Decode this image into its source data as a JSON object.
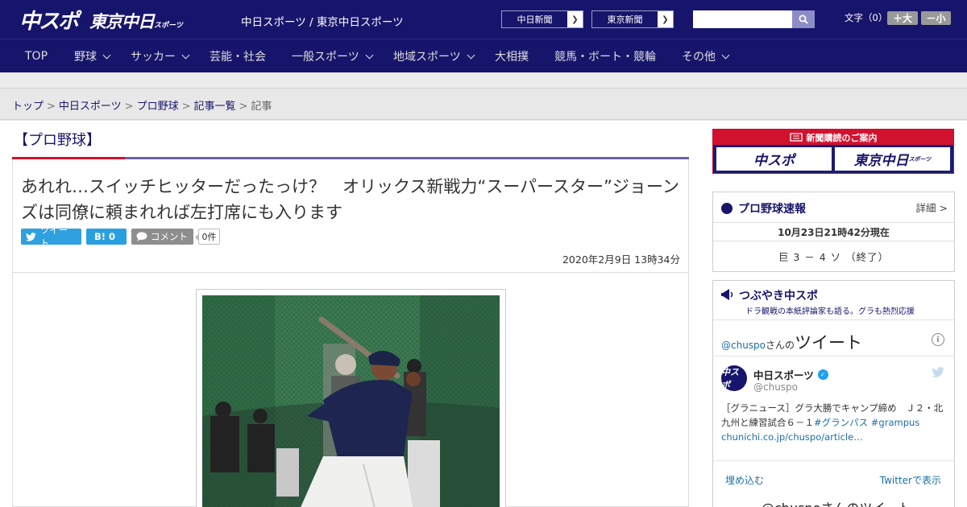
{
  "header": {
    "logo_main": "中スポ",
    "logo_sub": "東京中日",
    "logo_sub_small": "スポーツ",
    "site_name": "中日スポーツ / 東京中日スポーツ",
    "link_chunichi": "中日新聞",
    "link_tokyo": "東京新聞",
    "search_placeholder": "",
    "font_size_label": "文字（0）",
    "font_plus": "＋大",
    "font_minus": "－小"
  },
  "nav": {
    "items": [
      {
        "label": "TOP"
      },
      {
        "label": "野球"
      },
      {
        "label": "サッカー"
      },
      {
        "label": "芸能・社会"
      },
      {
        "label": "一般スポーツ"
      },
      {
        "label": "地域スポーツ"
      },
      {
        "label": "大相撲"
      },
      {
        "label": "競馬・ボート・競輪"
      },
      {
        "label": "その他"
      }
    ]
  },
  "breadcrumb": [
    "トップ",
    "中日スポーツ",
    "プロ野球",
    "記事一覧",
    "記事"
  ],
  "article": {
    "category": "【プロ野球】",
    "title": "あれれ…スイッチヒッターだったっけ？　オリックス新戦力“スーパースター”ジョーンズは同僚に頼まれれば左打席にも入ります",
    "tweet_label": "ツイート",
    "hatena_label": "B! 0",
    "comment_label": "コメント",
    "comment_count": "0件",
    "date": "2020年2月9日 13時34分"
  },
  "sidebar": {
    "subscribe_title": "新聞購読のご案内",
    "subscribe_1": "中スポ",
    "subscribe_2": "東京中日",
    "subscribe_2_small": "スポーツ",
    "score": {
      "title": "プロ野球速報",
      "detail": "詳細 >",
      "timestamp": "10月23日21時42分現在",
      "game": "巨 3 － 4 ソ （終了）"
    },
    "tweets": {
      "title": "つぶやき中スポ",
      "subtitle": "ドラ観戦の本紙評論家も語る。グラも熱烈応援",
      "handle_head": "@chuspo",
      "head_suffix": "さんの",
      "head_big": "ツイート",
      "avatar_text": "中スポ",
      "name": "中日スポーツ",
      "handle": "@chuspo",
      "text_plain": "［グラニュース］グラ大勝でキャンプ締め　Ｊ２・北九州と練習試合６－１",
      "tag1": "#グランパス",
      "tag2": "#grampus",
      "url": "chunichi.co.jp/chuspo/article…",
      "embed_link": "埋め込む",
      "view_link": "Twitterで表示",
      "footer_title": "@chuspoさんのツイート"
    }
  },
  "colors": {
    "brand": "#17156b",
    "accent_red": "#d2112f",
    "twitter": "#1da1f2"
  }
}
